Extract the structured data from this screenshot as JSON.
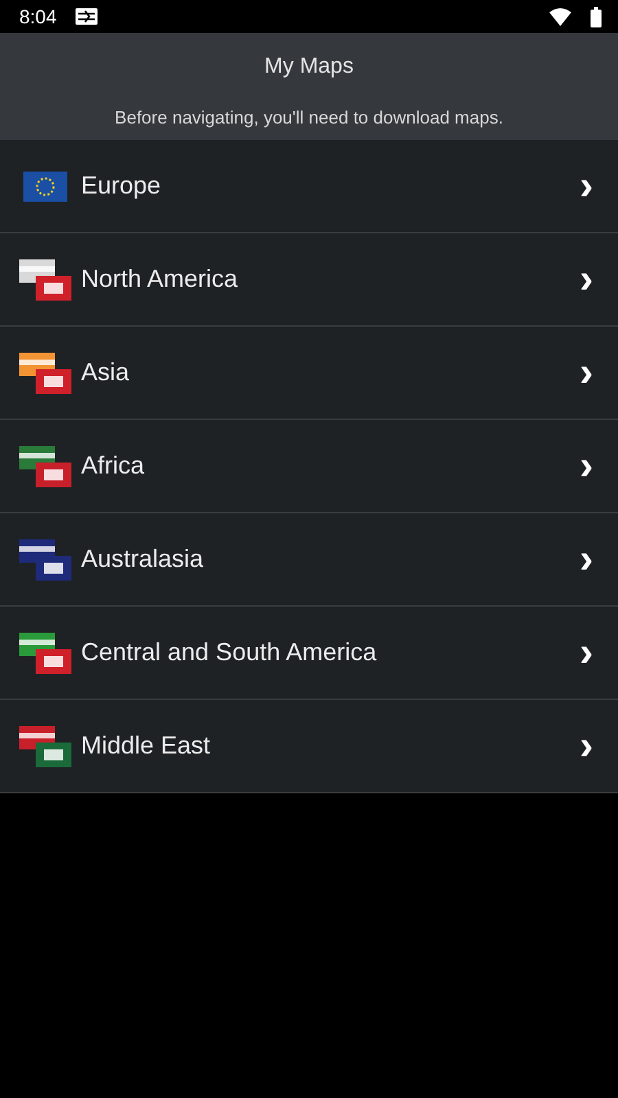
{
  "status_bar": {
    "time": "8:04"
  },
  "header": {
    "title": "My Maps",
    "subtitle": "Before navigating, you'll need to download maps."
  },
  "regions": [
    {
      "name": "Europe",
      "chevron": "›"
    },
    {
      "name": "North America",
      "chevron": "›"
    },
    {
      "name": "Asia",
      "chevron": "›"
    },
    {
      "name": "Africa",
      "chevron": "›"
    },
    {
      "name": "Australasia",
      "chevron": "›"
    },
    {
      "name": "Central and South America",
      "chevron": "›"
    },
    {
      "name": "Middle East",
      "chevron": "›"
    }
  ]
}
